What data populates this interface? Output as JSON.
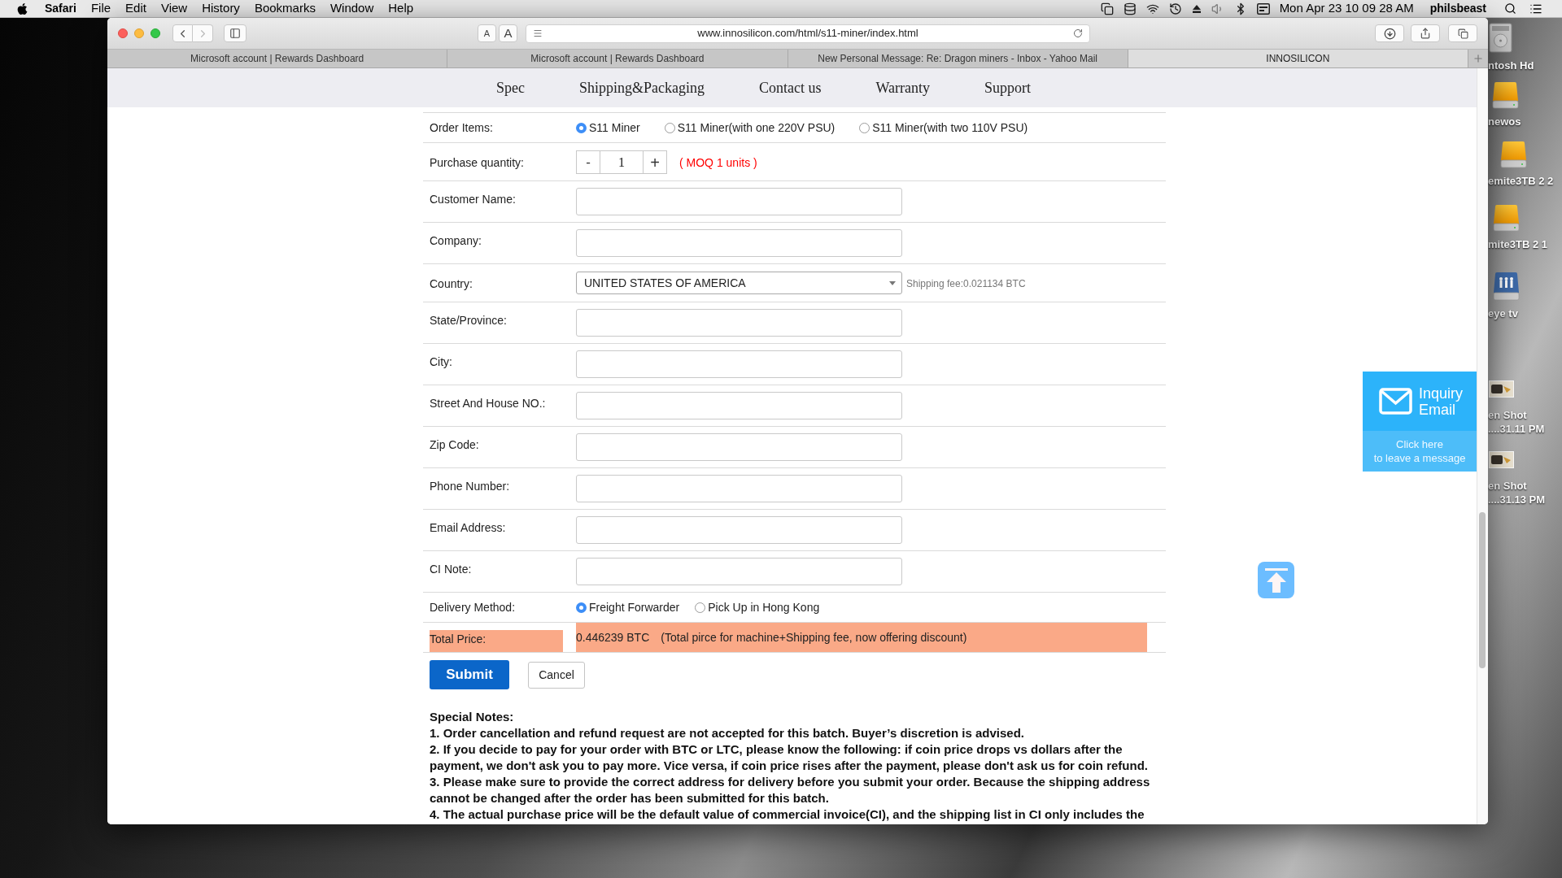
{
  "menu_bar": {
    "app": "Safari",
    "menus": [
      "File",
      "Edit",
      "View",
      "History",
      "Bookmarks",
      "Window",
      "Help"
    ],
    "clock": "Mon Apr 23 10 09 28 AM",
    "user": "philsbeast"
  },
  "browser": {
    "text_size_buttons": [
      {
        "kind": "smaller",
        "label": "A"
      },
      {
        "kind": "larger",
        "label": "A"
      }
    ],
    "address": "www.innosilicon.com/html/s11-miner/index.html",
    "tabs": [
      {
        "title": "Microsoft account | Rewards Dashboard",
        "selected": false
      },
      {
        "title": "Microsoft account | Rewards Dashboard",
        "selected": false
      },
      {
        "title": "New Personal Message: Re: Dragon miners - Inbox - Yahoo Mail",
        "selected": false
      },
      {
        "title": "INNOSILICON",
        "selected": true
      }
    ]
  },
  "site_nav": [
    "Spec",
    "Shipping&Packaging",
    "Contact us",
    "Warranty",
    "Support"
  ],
  "form": {
    "rows": [
      {
        "kind": "radio",
        "label": "Order Items:",
        "options": [
          {
            "label": "S11 Miner",
            "selected": true
          },
          {
            "label": "S11 Miner(with one 220V PSU)",
            "selected": false
          },
          {
            "label": "S11 Miner(with two 110V PSU)",
            "selected": false
          }
        ]
      },
      {
        "kind": "quantity",
        "label": "Purchase quantity:",
        "minus": "-",
        "value": "1",
        "plus": "+",
        "note": "( MOQ 1 units )"
      },
      {
        "kind": "text",
        "label": "Customer Name:"
      },
      {
        "kind": "text",
        "label": "Company:"
      },
      {
        "kind": "select",
        "label": "Country:",
        "value": "UNITED STATES OF AMERICA",
        "note": "Shipping fee:0.021134 BTC"
      },
      {
        "kind": "text",
        "label": "State/Province:"
      },
      {
        "kind": "text",
        "label": "City:"
      },
      {
        "kind": "text",
        "label": "Street And House NO.:"
      },
      {
        "kind": "text",
        "label": "Zip Code:"
      },
      {
        "kind": "text",
        "label": "Phone Number:"
      },
      {
        "kind": "text",
        "label": "Email Address:"
      },
      {
        "kind": "text",
        "label": "CI Note:"
      },
      {
        "kind": "radio",
        "label": "Delivery Method:",
        "options": [
          {
            "label": "Freight Forwarder",
            "selected": true
          },
          {
            "label": "Pick Up in Hong Kong",
            "selected": false
          }
        ]
      },
      {
        "kind": "total",
        "label": "Total Price:",
        "value": "0.446239 BTC",
        "note": "(Total pirce for machine+Shipping fee, now offering discount)"
      }
    ],
    "buttons": [
      {
        "kind": "primary",
        "label": "Submit"
      },
      {
        "kind": "secondary",
        "label": "Cancel"
      }
    ]
  },
  "special_notes": {
    "title": "Special Notes:",
    "items": [
      "1. Order cancellation and refund request are not accepted for this batch. Buyer’s discretion is advised.",
      "2. If you decide to pay for your order with BTC or LTC, please know the following: if coin price drops vs dollars after the payment, we don't ask you to pay more. Vice versa, if coin price rises after the payment, please don't ask us for coin refund.",
      "3. Please make sure to provide the correct address for delivery before you submit your order. Because the shipping address cannot be changed after the order has been submitted for this batch.",
      "4. The actual purchase price will be the default value of commercial invoice(CI), and the shipping list in CI only includes the"
    ]
  },
  "inquiry_widget": {
    "title": "Inquiry Email",
    "subtitle": "Click here\nto leave a message"
  },
  "desktop_icons": [
    {
      "kind": "hard-drive",
      "lines": [
        "ntosh Hd"
      ]
    },
    {
      "kind": "external-drive",
      "lines": [
        "newos"
      ]
    },
    {
      "kind": "external-drive",
      "lines": [
        "emite3TB 2 2"
      ]
    },
    {
      "kind": "external-drive",
      "lines": [
        "mite3TB 2 1"
      ]
    },
    {
      "kind": "network-drive",
      "lines": [
        "eye tv"
      ]
    },
    {
      "kind": "image-file",
      "lines": [
        "en Shot",
        "....31.11 PM"
      ]
    },
    {
      "kind": "image-file",
      "lines": [
        "en Shot",
        "....31.13 PM"
      ]
    }
  ]
}
